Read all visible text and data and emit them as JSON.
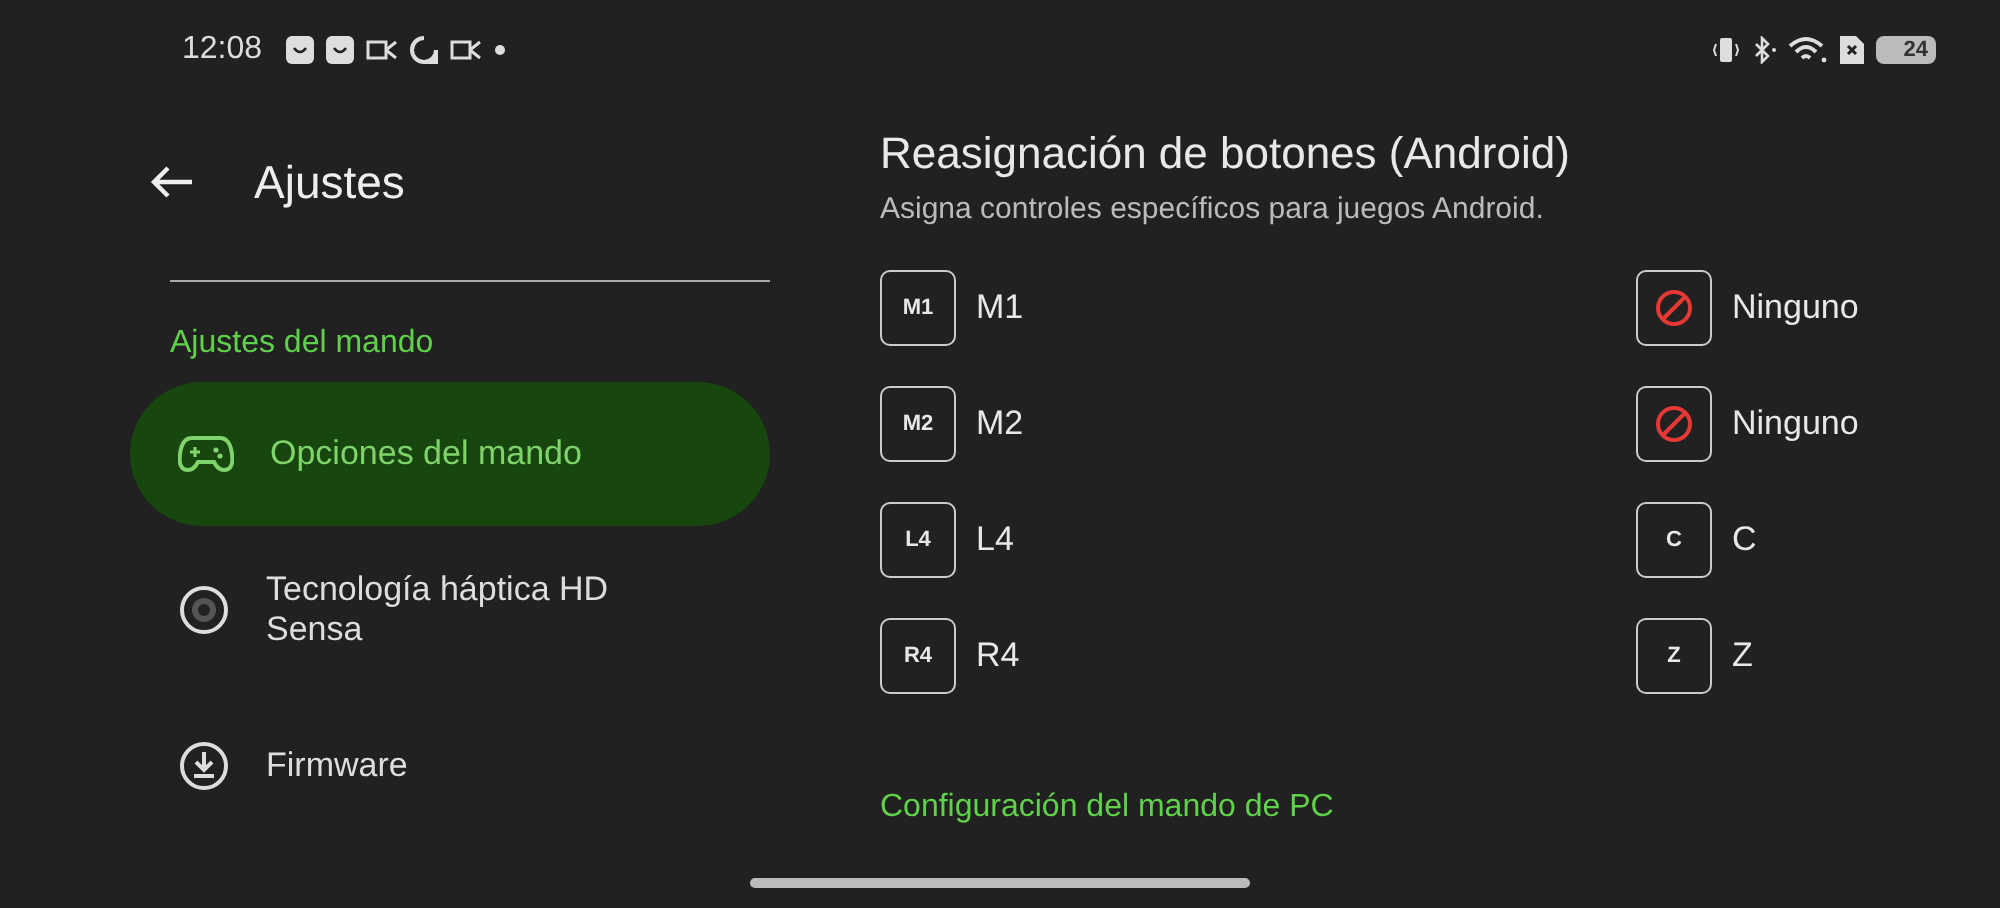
{
  "status_bar": {
    "time": "12:08",
    "battery": "24"
  },
  "sidebar": {
    "title": "Ajustes",
    "section": "Ajustes del mando",
    "items": [
      {
        "kind": "gamepad",
        "label": "Opciones del mando",
        "selected": true
      },
      {
        "kind": "haptic",
        "label": "Tecnología háptica HD Sensa",
        "selected": false
      },
      {
        "kind": "download",
        "label": "Firmware",
        "selected": false
      }
    ]
  },
  "content": {
    "title": "Reasignación de botones (Android)",
    "subtitle": "Asigna controles específicos para juegos Android.",
    "mappings": [
      {
        "source_key": "M1",
        "source_label": "M1",
        "target": {
          "kind": "none",
          "label": "Ninguno"
        }
      },
      {
        "source_key": "M2",
        "source_label": "M2",
        "target": {
          "kind": "none",
          "label": "Ninguno"
        }
      },
      {
        "source_key": "L4",
        "source_label": "L4",
        "target": {
          "kind": "key",
          "key": "C",
          "label": "C"
        }
      },
      {
        "source_key": "R4",
        "source_label": "R4",
        "target": {
          "kind": "key",
          "key": "Z",
          "label": "Z"
        }
      }
    ],
    "next_section": "Configuración del mando de PC"
  }
}
